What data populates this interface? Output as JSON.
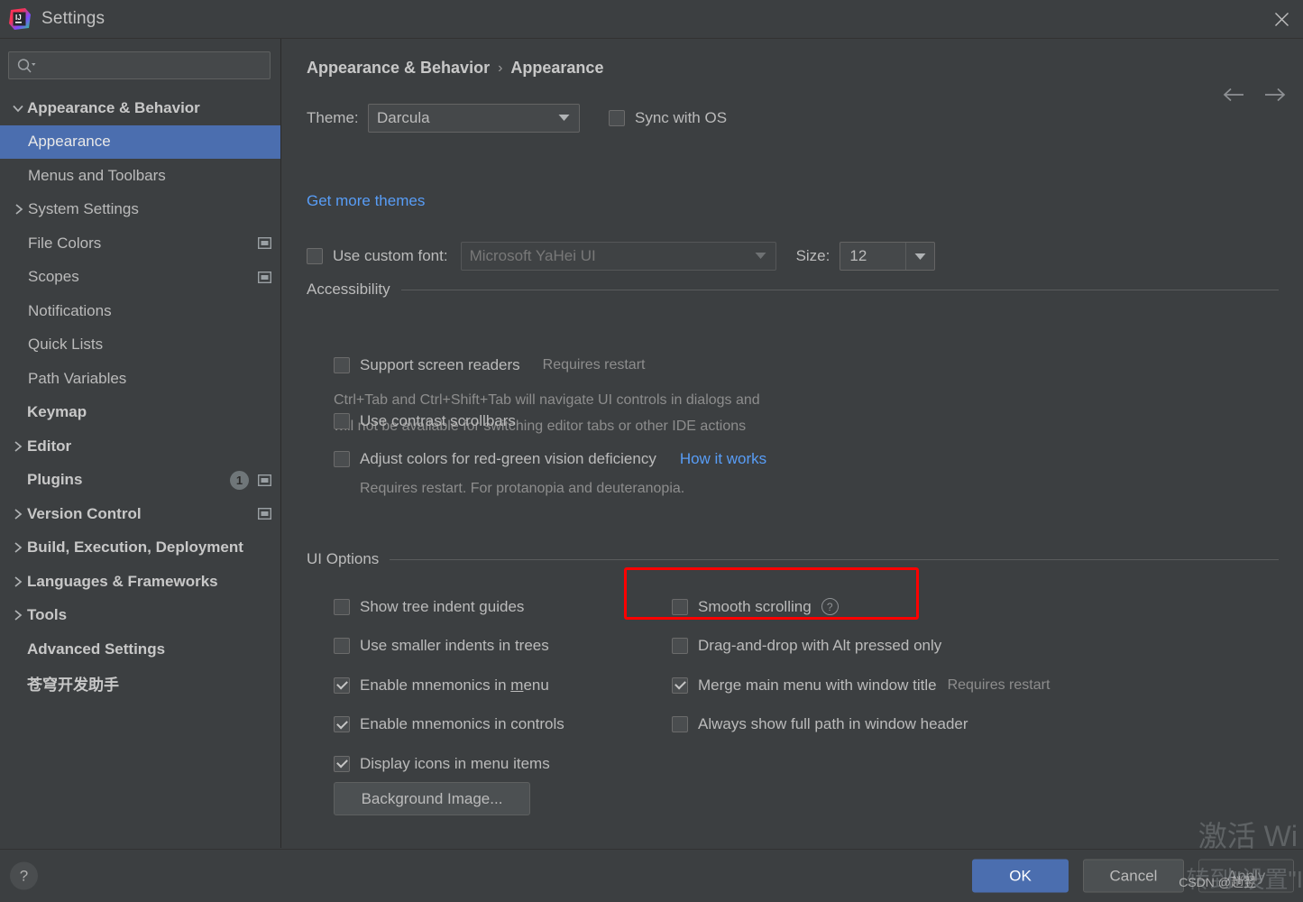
{
  "window": {
    "title": "Settings",
    "logo_icon": "intellij-idea-logo-icon",
    "close_icon": "close-icon"
  },
  "sidebar": {
    "search": {
      "placeholder": "",
      "value": "",
      "icon": "search-icon"
    },
    "items": [
      {
        "label": "Appearance & Behavior",
        "level": 1,
        "bold": true,
        "arrow": "chevron-down-icon",
        "selected": false
      },
      {
        "label": "Appearance",
        "level": 2,
        "bold": false,
        "arrow": "",
        "selected": true
      },
      {
        "label": "Menus and Toolbars",
        "level": 2,
        "bold": false,
        "arrow": "",
        "selected": false
      },
      {
        "label": "System Settings",
        "level": 2,
        "bold": false,
        "arrow": "chevron-right-icon",
        "selected": false
      },
      {
        "label": "File Colors",
        "level": 2,
        "bold": false,
        "arrow": "",
        "selected": false,
        "project_icon": true
      },
      {
        "label": "Scopes",
        "level": 2,
        "bold": false,
        "arrow": "",
        "selected": false,
        "project_icon": true
      },
      {
        "label": "Notifications",
        "level": 2,
        "bold": false,
        "arrow": "",
        "selected": false
      },
      {
        "label": "Quick Lists",
        "level": 2,
        "bold": false,
        "arrow": "",
        "selected": false
      },
      {
        "label": "Path Variables",
        "level": 2,
        "bold": false,
        "arrow": "",
        "selected": false
      },
      {
        "label": "Keymap",
        "level": 1,
        "bold": true,
        "arrow": "",
        "selected": false
      },
      {
        "label": "Editor",
        "level": 1,
        "bold": true,
        "arrow": "chevron-right-icon",
        "selected": false
      },
      {
        "label": "Plugins",
        "level": 1,
        "bold": true,
        "arrow": "",
        "selected": false,
        "badge": "1",
        "project_icon": true
      },
      {
        "label": "Version Control",
        "level": 1,
        "bold": true,
        "arrow": "chevron-right-icon",
        "selected": false,
        "project_icon": true
      },
      {
        "label": "Build, Execution, Deployment",
        "level": 1,
        "bold": true,
        "arrow": "chevron-right-icon",
        "selected": false
      },
      {
        "label": "Languages & Frameworks",
        "level": 1,
        "bold": true,
        "arrow": "chevron-right-icon",
        "selected": false
      },
      {
        "label": "Tools",
        "level": 1,
        "bold": true,
        "arrow": "chevron-right-icon",
        "selected": false
      },
      {
        "label": "Advanced Settings",
        "level": 1,
        "bold": true,
        "arrow": "",
        "selected": false
      },
      {
        "label": "苍穹开发助手",
        "level": 1,
        "bold": true,
        "arrow": "",
        "selected": false
      }
    ]
  },
  "breadcrumb": {
    "parent": "Appearance & Behavior",
    "separator": "›",
    "current": "Appearance",
    "back_icon": "arrow-left-icon",
    "forward_icon": "arrow-right-icon"
  },
  "theme": {
    "label": "Theme:",
    "value": "Darcula",
    "sync_with_os_label": "Sync with OS",
    "sync_with_os_checked": false,
    "get_more_themes": "Get more themes"
  },
  "font": {
    "use_custom_font_label": "Use custom font:",
    "use_custom_font_checked": false,
    "font_value": "Microsoft YaHei UI",
    "size_label": "Size:",
    "size_value": "12"
  },
  "accessibility": {
    "section_title": "Accessibility",
    "screen_readers_label": "Support screen readers",
    "screen_readers_checked": false,
    "screen_readers_note": "Requires restart",
    "description_line1": "Ctrl+Tab and Ctrl+Shift+Tab will navigate UI controls in dialogs and",
    "description_line2": "will not be available for switching editor tabs or other IDE actions",
    "contrast_scrollbars_label": "Use contrast scrollbars",
    "contrast_scrollbars_checked": false,
    "adjust_colors_label": "Adjust colors for red-green vision deficiency",
    "adjust_colors_checked": false,
    "how_it_works_link": "How it works",
    "adjust_colors_note": "Requires restart. For protanopia and deuteranopia."
  },
  "ui_options": {
    "section_title": "UI Options",
    "left": [
      {
        "label": "Show tree indent guides",
        "checked": false
      },
      {
        "label": "Use smaller indents in trees",
        "checked": false
      },
      {
        "label": "Enable mnemonics in menu",
        "checked": true,
        "mnemonic": "m"
      },
      {
        "label": "Enable mnemonics in controls",
        "checked": true
      },
      {
        "label": "Display icons in menu items",
        "checked": true
      }
    ],
    "right": [
      {
        "label": "Smooth scrolling",
        "checked": false,
        "help_icon": true,
        "highlighted": true
      },
      {
        "label": "Drag-and-drop with Alt pressed only",
        "checked": false
      },
      {
        "label": "Merge main menu with window title",
        "checked": true,
        "note": "Requires restart"
      },
      {
        "label": "Always show full path in window header",
        "checked": false
      }
    ],
    "background_image_button": "Background Image..."
  },
  "footer": {
    "help_label": "?",
    "ok_label": "OK",
    "cancel_label": "Cancel",
    "apply_label": "Apply"
  },
  "watermark": {
    "line1": "激活 Wi",
    "line2": "转到\"设置\"I",
    "csdn": "CSDN @趟翌"
  },
  "colors": {
    "background": "#3c3f41",
    "selection": "#4b6eaf",
    "link": "#589df6",
    "highlight": "#ff0000",
    "text": "#bbbbbb"
  }
}
